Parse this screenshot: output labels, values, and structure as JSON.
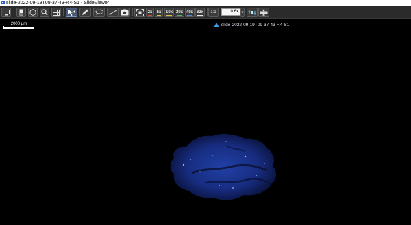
{
  "window": {
    "title": "slide-2022-09-19T09-37-43-R4-S1 - SlideViewer"
  },
  "toolbar": {
    "zoom_presets": [
      "2x",
      "5x",
      "10x",
      "20x",
      "40x",
      "63x"
    ],
    "one_to_one": "1:1",
    "zoom_value": "0.6x"
  },
  "scalebar": {
    "label": "2000 µm"
  },
  "slide": {
    "name": "slide-2022-09-19T09-37-43-R4-S1",
    "color": "#3aa0e8"
  },
  "colors": {
    "background": "#000000",
    "toolbar": "#2b2b2b",
    "tissue_fluorescence": "#1a3a9c"
  }
}
